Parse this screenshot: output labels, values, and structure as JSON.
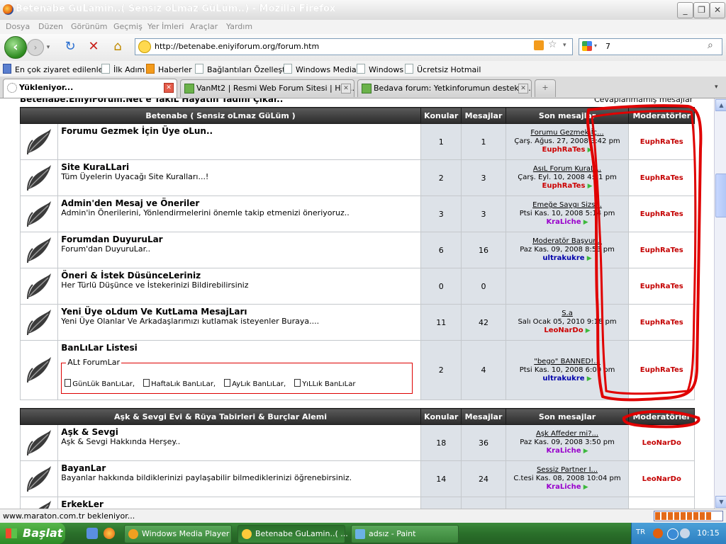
{
  "window": {
    "title": "Betenabe GuLamin..( Sensiz oLmaz GüLüm..) - Mozilla Firefox"
  },
  "menu": [
    "Dosya",
    "Düzen",
    "Görünüm",
    "Geçmiş",
    "Yer İmleri",
    "Araçlar",
    "Yardım"
  ],
  "address": {
    "url": "http://betenabe.eniyiforum.org/forum.htm"
  },
  "search": {
    "value": "7"
  },
  "bookmarks": [
    "En çok ziyaret edilenler",
    "İlk Adım",
    "Haberler",
    "Bağlantıları Özelleştir",
    "Windows Media",
    "Windows",
    "Ücretsiz Hotmail"
  ],
  "tabs": [
    {
      "label": "Yükleniyor..."
    },
    {
      "label": "VanMt2 | Resmi Web Forum Sitesi | Hoş..."
    },
    {
      "label": "Bedava forum: Yetkinforumun destek f..."
    }
  ],
  "page": {
    "top_text": "Betenabe.EniyiForum.Net e TakıL Hayatın Tadını Çıkar..",
    "top_right": "Cevaplanmamış mesajlar",
    "section1": {
      "title": "Betenabe ( Sensiz oLmaz GüLüm )",
      "col_topics": "Konular",
      "col_posts": "Mesajlar",
      "col_last": "Son mesajlar",
      "col_mods": "Moderatörler",
      "forums": [
        {
          "name": "Forumu Gezmek İçin Üye oLun..",
          "desc": "",
          "topics": "1",
          "posts": "1",
          "last_title": "Forumu Gezmek İç...",
          "last_date": "Çarş. Ağus. 27, 2008 3:42 pm",
          "last_user": "EuphRaTes",
          "user_color": "#cc0000",
          "mod": "EuphRaTes"
        },
        {
          "name": "Site KuraLLari",
          "desc": "Tüm Üyelerin Uyacağı Site Kuralları...!",
          "topics": "2",
          "posts": "3",
          "last_title": "AsıL Forum KuraL...",
          "last_date": "Çarş. Eyl. 10, 2008 4:31 pm",
          "last_user": "EuphRaTes",
          "user_color": "#cc0000",
          "mod": "EuphRaTes"
        },
        {
          "name": "Admin'den Mesaj ve Öneriler",
          "desc": "Admin'in Önerilerini, Yönlendirmelerini önemle takip etmenizi öneriyoruz..",
          "topics": "3",
          "posts": "3",
          "last_title": "Emeğe Saygı Sizs...",
          "last_date": "Ptsi Kas. 10, 2008 5:14 pm",
          "last_user": "KraLiche",
          "user_color": "#9900cc",
          "mod": "EuphRaTes"
        },
        {
          "name": "Forumdan DuyuruLar",
          "desc": "Forum'dan DuyuruLar..",
          "topics": "6",
          "posts": "16",
          "last_title": "Moderatör Başvur...",
          "last_date": "Paz Kas. 09, 2008 8:53 pm",
          "last_user": "ultrakukre",
          "user_color": "#0000aa",
          "mod": "EuphRaTes"
        },
        {
          "name": "Öneri & İstek DüsünceLeriniz",
          "desc": "Her Türlü Düşünce ve İstekerinizi Bildirebilirsiniz",
          "topics": "0",
          "posts": "0",
          "last_title": "",
          "last_date": "",
          "last_user": "",
          "user_color": "#000000",
          "mod": "EuphRaTes"
        },
        {
          "name": "Yeni Üye oLdum Ve KutLama MesajLarı",
          "desc": "Yeni Üye Olanlar Ve Arkadaşlarımızı kutlamak isteyenler Buraya....",
          "topics": "11",
          "posts": "42",
          "last_title": "S.a",
          "last_date": "Salı Ocak 05, 2010 9:18 pm",
          "last_user": "LeoNarDo",
          "user_color": "#cc0000",
          "mod": "EuphRaTes"
        },
        {
          "name": "BanLıLar Listesi",
          "desc": "",
          "topics": "2",
          "posts": "4",
          "last_title": "\"bego\" BANNED!...",
          "last_date": "Ptsi Kas. 10, 2008 6:00 pm",
          "last_user": "ultrakukre",
          "user_color": "#0000aa",
          "mod": "EuphRaTes"
        }
      ],
      "subforums": {
        "legend": "ALt ForumLar",
        "items": [
          "GünLük BanLıLar,",
          "HaftaLık BanLıLar,",
          "AyLık BanLıLar,",
          "YıLLık BanLıLar"
        ]
      }
    },
    "section2": {
      "title": "Aşk & Sevgi Evi & Rüya Tabirleri & Burçlar Alemi",
      "col_topics": "Konular",
      "col_posts": "Mesajlar",
      "col_last": "Son mesajlar",
      "col_mods": "Moderatörler",
      "forums": [
        {
          "name": "Aşk & Sevgi",
          "desc": "Aşk & Sevgi Hakkında Herşey..",
          "topics": "18",
          "posts": "36",
          "last_title": "Aşk Affeder mi?...",
          "last_date": "Paz Kas. 09, 2008 3:50 pm",
          "last_user": "KraLiche",
          "user_color": "#9900cc",
          "mod": "LeoNarDo"
        },
        {
          "name": "BayanLar",
          "desc": "Bayanlar hakkında bildiklerinizi paylaşabilir bilmediklerinizi öğrenebirsiniz.",
          "topics": "14",
          "posts": "24",
          "last_title": "Sessiz Partner I...",
          "last_date": "C.tesi Kas. 08, 2008 10:04 pm",
          "last_user": "KraLiche",
          "user_color": "#9900cc",
          "mod": "LeoNarDo"
        },
        {
          "name": "ErkekLer",
          "desc": "",
          "topics": "",
          "posts": "",
          "last_title": "",
          "last_date": "",
          "last_user": "",
          "user_color": "#000000",
          "mod": ""
        }
      ]
    }
  },
  "status": {
    "text": "www.maraton.com.tr bekleniyor...",
    "progress": 0.85
  },
  "taskbar": {
    "start": "Başlat",
    "tasks": [
      "Windows Media Player",
      "Betenabe GuLamin..( ...",
      "adsız - Paint"
    ],
    "lang": "TR",
    "clock": "10:15"
  }
}
